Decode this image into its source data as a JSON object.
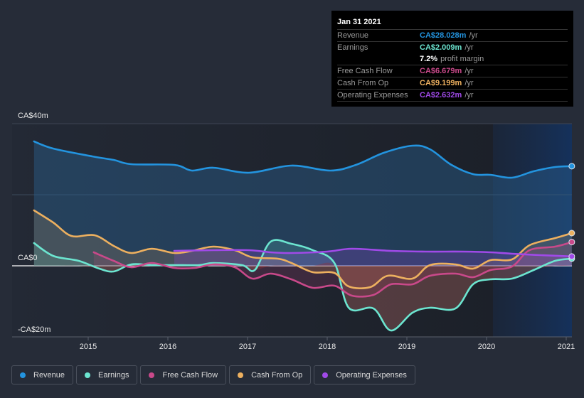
{
  "tooltip": {
    "date": "Jan 31 2021",
    "rows": [
      {
        "label": "Revenue",
        "value": "CA$28.028m",
        "unit": "/yr",
        "color": "#2394df"
      },
      {
        "label": "Earnings",
        "value": "CA$2.009m",
        "unit": "/yr",
        "color": "#6ce5d0"
      },
      {
        "label": "",
        "value": "7.2%",
        "unit": "profit margin",
        "color": "#ffffff"
      },
      {
        "label": "Free Cash Flow",
        "value": "CA$6.679m",
        "unit": "/yr",
        "color": "#c9498a"
      },
      {
        "label": "Cash From Op",
        "value": "CA$9.199m",
        "unit": "/yr",
        "color": "#edb05f"
      },
      {
        "label": "Operating Expenses",
        "value": "CA$2.632m",
        "unit": "/yr",
        "color": "#a04ae8"
      }
    ]
  },
  "legend": [
    {
      "label": "Revenue",
      "color": "#2394df"
    },
    {
      "label": "Earnings",
      "color": "#6ce5d0"
    },
    {
      "label": "Free Cash Flow",
      "color": "#c9498a"
    },
    {
      "label": "Cash From Op",
      "color": "#edb05f"
    },
    {
      "label": "Operating Expenses",
      "color": "#a04ae8"
    }
  ],
  "chart_data": {
    "type": "area",
    "title": "",
    "xlabel": "",
    "ylabel": "",
    "units": "CA$ millions",
    "ylim": [
      -20,
      40
    ],
    "xlim": [
      2014.32,
      2021.07
    ],
    "yticks": [
      {
        "value": 40,
        "label": "CA$40m"
      },
      {
        "value": 0,
        "label": "CA$0"
      },
      {
        "value": -20,
        "label": "-CA$20m"
      }
    ],
    "xticks": [
      {
        "value": 2015,
        "label": "2015"
      },
      {
        "value": 2016,
        "label": "2016"
      },
      {
        "value": 2017,
        "label": "2017"
      },
      {
        "value": 2018,
        "label": "2018"
      },
      {
        "value": 2019,
        "label": "2019"
      },
      {
        "value": 2020,
        "label": "2020"
      },
      {
        "value": 2021,
        "label": "2021"
      }
    ],
    "grid": true,
    "highlight_from": 2020.08,
    "legend_position": "bottom",
    "series": [
      {
        "name": "Revenue",
        "color": "#2394df",
        "points": [
          [
            2014.32,
            35.0
          ],
          [
            2014.56,
            33.0
          ],
          [
            2015.05,
            30.8
          ],
          [
            2015.32,
            29.8
          ],
          [
            2015.54,
            28.6
          ],
          [
            2016.08,
            28.4
          ],
          [
            2016.3,
            26.8
          ],
          [
            2016.57,
            27.6
          ],
          [
            2017.02,
            26.2
          ],
          [
            2017.55,
            28.2
          ],
          [
            2018.04,
            26.8
          ],
          [
            2018.36,
            28.4
          ],
          [
            2018.71,
            31.8
          ],
          [
            2019.07,
            33.8
          ],
          [
            2019.29,
            32.8
          ],
          [
            2019.56,
            28.4
          ],
          [
            2019.83,
            25.8
          ],
          [
            2020.05,
            25.6
          ],
          [
            2020.32,
            24.8
          ],
          [
            2020.59,
            26.6
          ],
          [
            2020.86,
            27.8
          ],
          [
            2021.07,
            28.03
          ]
        ]
      },
      {
        "name": "Earnings",
        "color": "#6ce5d0",
        "points": [
          [
            2014.32,
            6.4
          ],
          [
            2014.56,
            2.8
          ],
          [
            2014.88,
            1.4
          ],
          [
            2015.14,
            -0.8
          ],
          [
            2015.32,
            -1.6
          ],
          [
            2015.54,
            0.4
          ],
          [
            2015.8,
            0.2
          ],
          [
            2016.08,
            0.2
          ],
          [
            2016.39,
            0.2
          ],
          [
            2016.57,
            0.8
          ],
          [
            2016.93,
            0.2
          ],
          [
            2017.09,
            -1.2
          ],
          [
            2017.29,
            6.8
          ],
          [
            2017.55,
            6.2
          ],
          [
            2017.82,
            4.4
          ],
          [
            2018.09,
            0.8
          ],
          [
            2018.27,
            -11.8
          ],
          [
            2018.58,
            -12.0
          ],
          [
            2018.8,
            -18.2
          ],
          [
            2019.07,
            -13.2
          ],
          [
            2019.29,
            -11.8
          ],
          [
            2019.61,
            -12.0
          ],
          [
            2019.83,
            -5.2
          ],
          [
            2020.05,
            -3.8
          ],
          [
            2020.32,
            -3.6
          ],
          [
            2020.59,
            -1.2
          ],
          [
            2020.86,
            1.4
          ],
          [
            2021.07,
            2.01
          ]
        ]
      },
      {
        "name": "Free Cash Flow",
        "color": "#c9498a",
        "points": [
          [
            2015.07,
            3.8
          ],
          [
            2015.32,
            1.4
          ],
          [
            2015.54,
            -0.4
          ],
          [
            2015.8,
            0.8
          ],
          [
            2016.08,
            -0.6
          ],
          [
            2016.34,
            -0.6
          ],
          [
            2016.57,
            0.4
          ],
          [
            2016.84,
            -0.4
          ],
          [
            2017.06,
            -3.6
          ],
          [
            2017.29,
            -2.2
          ],
          [
            2017.55,
            -3.8
          ],
          [
            2017.82,
            -6.2
          ],
          [
            2018.09,
            -5.6
          ],
          [
            2018.31,
            -8.4
          ],
          [
            2018.58,
            -8.2
          ],
          [
            2018.8,
            -5.2
          ],
          [
            2019.07,
            -5.2
          ],
          [
            2019.29,
            -2.8
          ],
          [
            2019.61,
            -2.2
          ],
          [
            2019.83,
            -3.2
          ],
          [
            2020.05,
            -1.2
          ],
          [
            2020.32,
            -0.2
          ],
          [
            2020.54,
            4.4
          ],
          [
            2020.86,
            5.4
          ],
          [
            2021.07,
            6.68
          ]
        ]
      },
      {
        "name": "Cash From Op",
        "color": "#edb05f",
        "points": [
          [
            2014.32,
            15.6
          ],
          [
            2014.56,
            12.2
          ],
          [
            2014.79,
            8.4
          ],
          [
            2015.08,
            8.6
          ],
          [
            2015.32,
            5.6
          ],
          [
            2015.54,
            3.6
          ],
          [
            2015.8,
            4.8
          ],
          [
            2016.08,
            3.6
          ],
          [
            2016.3,
            4.2
          ],
          [
            2016.57,
            5.4
          ],
          [
            2016.84,
            4.4
          ],
          [
            2017.06,
            2.4
          ],
          [
            2017.38,
            2.0
          ],
          [
            2017.55,
            0.8
          ],
          [
            2017.82,
            -1.8
          ],
          [
            2018.09,
            -2.0
          ],
          [
            2018.27,
            -5.8
          ],
          [
            2018.54,
            -6.0
          ],
          [
            2018.76,
            -2.8
          ],
          [
            2019.07,
            -3.6
          ],
          [
            2019.29,
            0.2
          ],
          [
            2019.61,
            0.4
          ],
          [
            2019.83,
            -0.8
          ],
          [
            2020.05,
            1.6
          ],
          [
            2020.32,
            1.8
          ],
          [
            2020.54,
            5.8
          ],
          [
            2020.86,
            7.8
          ],
          [
            2021.07,
            9.2
          ]
        ]
      },
      {
        "name": "Operating Expenses",
        "color": "#a04ae8",
        "points": [
          [
            2016.08,
            4.2
          ],
          [
            2016.57,
            4.4
          ],
          [
            2017.02,
            4.4
          ],
          [
            2017.29,
            3.8
          ],
          [
            2017.55,
            3.6
          ],
          [
            2018.0,
            4.0
          ],
          [
            2018.31,
            4.8
          ],
          [
            2018.8,
            4.2
          ],
          [
            2019.25,
            4.0
          ],
          [
            2019.7,
            4.0
          ],
          [
            2020.05,
            3.8
          ],
          [
            2020.32,
            3.4
          ],
          [
            2020.68,
            3.0
          ],
          [
            2021.07,
            2.63
          ]
        ]
      }
    ]
  }
}
